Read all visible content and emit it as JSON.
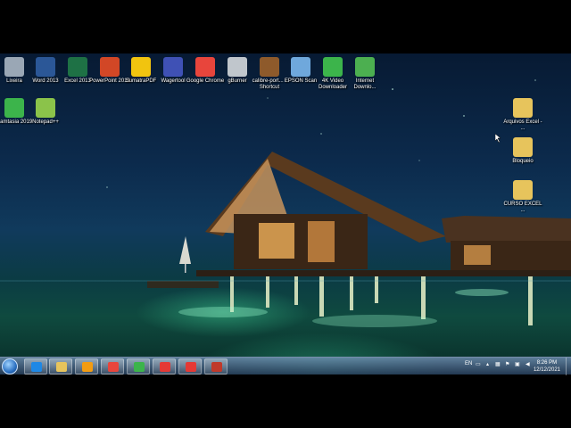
{
  "desktop": {
    "icons_top_row": [
      {
        "label": "Lixeira",
        "icon": "recycle-bin-icon",
        "color": "#9aa7b5"
      },
      {
        "label": "Word 2013",
        "icon": "word-icon",
        "color": "#2b5797"
      },
      {
        "label": "Excel 2013",
        "icon": "excel-icon",
        "color": "#1e7145"
      },
      {
        "label": "PowerPoint 2013",
        "icon": "powerpoint-icon",
        "color": "#d24726"
      },
      {
        "label": "SumatraPDF",
        "icon": "pdf-icon",
        "color": "#f1c40f"
      },
      {
        "label": "Wagertool",
        "icon": "wagertool-icon",
        "color": "#3f51b5"
      },
      {
        "label": "Google Chrome",
        "icon": "chrome-icon",
        "color": "#e8453c"
      },
      {
        "label": "gBurner",
        "icon": "gburner-icon",
        "color": "#c0c6cc"
      },
      {
        "label": "calibre-port... - Shortcut",
        "icon": "calibre-icon",
        "color": "#8e5a2b"
      },
      {
        "label": "EPSON Scan",
        "icon": "scanner-icon",
        "color": "#6fa8dc"
      },
      {
        "label": "4K Video Downloader",
        "icon": "download-icon",
        "color": "#3cb44b"
      },
      {
        "label": "Internet Downlo...",
        "icon": "internet-download-icon",
        "color": "#4caf50"
      }
    ],
    "icons_second_row": [
      {
        "label": "Camtasia 2019",
        "icon": "camtasia-icon",
        "color": "#3cb44b"
      },
      {
        "label": "Notepad++",
        "icon": "notepad-icon",
        "color": "#8bc34a"
      }
    ],
    "icons_right": [
      {
        "label": "Arquivos Excel - ...",
        "icon": "folder-icon",
        "color": "#e7c45c"
      },
      {
        "label": "Bloqueio",
        "icon": "folder-icon",
        "color": "#e7c45c"
      },
      {
        "label": "CURSO EXCEL ...",
        "icon": "folder-icon",
        "color": "#e7c45c"
      }
    ]
  },
  "taskbar": {
    "start_icon": "windows-start-icon",
    "pinned": [
      {
        "icon": "internet-explorer-icon",
        "color": "#1e88e5"
      },
      {
        "icon": "file-explorer-icon",
        "color": "#e7c45c"
      },
      {
        "icon": "media-player-icon",
        "color": "#f39c12"
      },
      {
        "icon": "chrome-icon",
        "color": "#e8453c"
      },
      {
        "icon": "camtasia-icon",
        "color": "#3cb44b"
      },
      {
        "icon": "pdf-reader-icon",
        "color": "#e53935"
      },
      {
        "icon": "camtasia-recorder-icon",
        "color": "#e53935"
      },
      {
        "icon": "recorder-icon",
        "color": "#c0392b"
      }
    ],
    "language": "EN",
    "time": "8:26 PM",
    "date": "12/12/2021"
  }
}
